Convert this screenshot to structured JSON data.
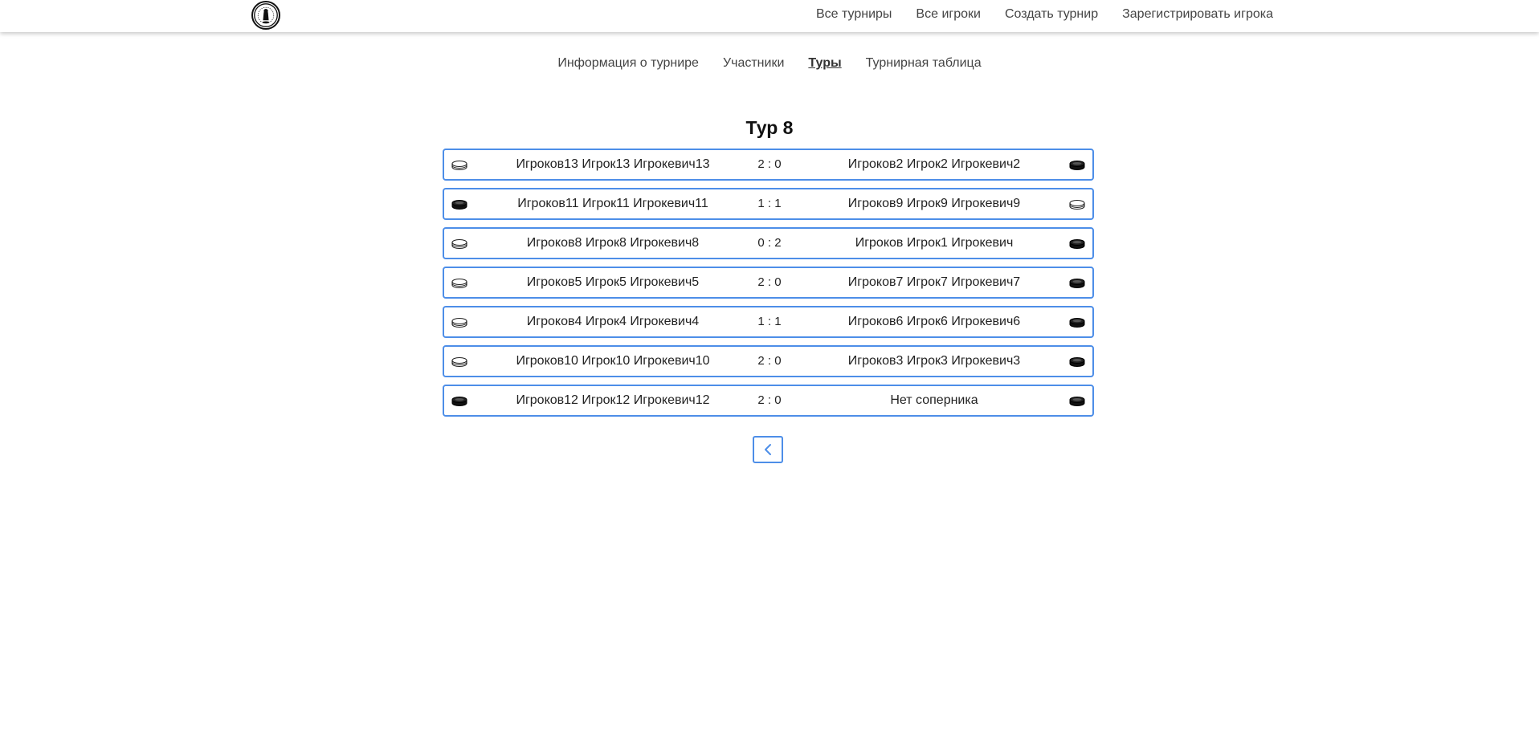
{
  "header": {
    "logo_icon": "club-logo-icon",
    "nav": [
      {
        "label": "Все турниры"
      },
      {
        "label": "Все игроки"
      },
      {
        "label": "Создать турнир"
      },
      {
        "label": "Зарегистрировать игрока"
      }
    ]
  },
  "tabs": [
    {
      "label": "Информация о турнире",
      "active": false
    },
    {
      "label": "Участники",
      "active": false
    },
    {
      "label": "Туры",
      "active": true
    },
    {
      "label": "Турнирная таблица",
      "active": false
    }
  ],
  "round": {
    "title": "Тур 8",
    "matches": [
      {
        "player1": "Игроков13 Игрок13 Игрокевич13",
        "score": "2 : 0",
        "player2": "Игроков2 Игрок2 Игрокевич2",
        "left_puck": "white",
        "right_puck": "black"
      },
      {
        "player1": "Игроков11 Игрок11 Игрокевич11",
        "score": "1 : 1",
        "player2": "Игроков9 Игрок9 Игрокевич9",
        "left_puck": "black",
        "right_puck": "white"
      },
      {
        "player1": "Игроков8 Игрок8 Игрокевич8",
        "score": "0 : 2",
        "player2": "Игроков Игрок1 Игрокевич",
        "left_puck": "white",
        "right_puck": "black"
      },
      {
        "player1": "Игроков5 Игрок5 Игрокевич5",
        "score": "2 : 0",
        "player2": "Игроков7 Игрок7 Игрокевич7",
        "left_puck": "white",
        "right_puck": "black"
      },
      {
        "player1": "Игроков4 Игрок4 Игрокевич4",
        "score": "1 : 1",
        "player2": "Игроков6 Игрок6 Игрокевич6",
        "left_puck": "white",
        "right_puck": "black"
      },
      {
        "player1": "Игроков10 Игрок10 Игрокевич10",
        "score": "2 : 0",
        "player2": "Игроков3 Игрок3 Игрокевич3",
        "left_puck": "white",
        "right_puck": "black"
      },
      {
        "player1": "Игроков12 Игрок12 Игрокевич12",
        "score": "2 : 0",
        "player2": "Нет соперника",
        "left_puck": "black",
        "right_puck": "black"
      }
    ]
  },
  "pagination": {
    "prev_icon": "chevron-left-icon"
  },
  "colors": {
    "accent": "#4d8ee8",
    "text": "#222222",
    "nav_text": "#444444"
  }
}
